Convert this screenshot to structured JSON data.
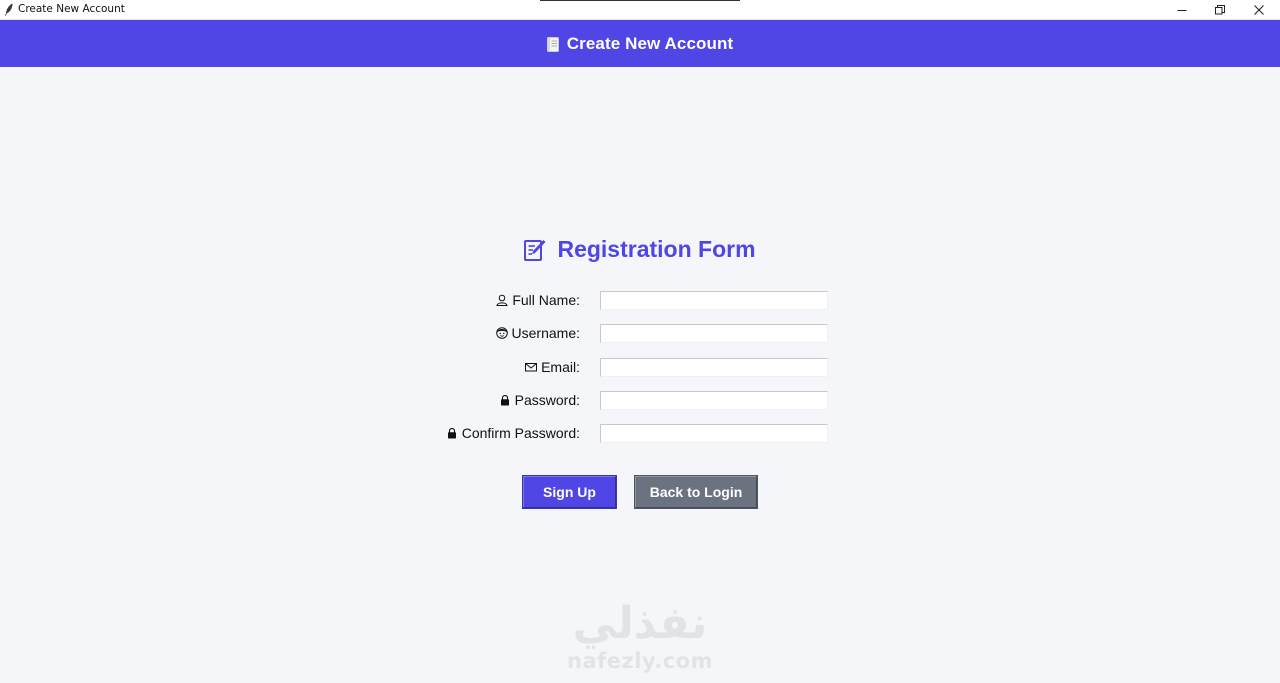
{
  "window": {
    "title": "Create New Account",
    "controls": {
      "minimize": "minimize-icon",
      "maximize": "restore-icon",
      "close": "close-icon"
    }
  },
  "header": {
    "title": "Create New Account",
    "icon": "notebook-icon",
    "background": "#4f46e5"
  },
  "form": {
    "title": "Registration Form",
    "title_icon": "pencil-note-icon",
    "accent": "#4f46e5",
    "fields": [
      {
        "label": "Full Name:",
        "icon": "person-icon",
        "value": ""
      },
      {
        "label": "Username:",
        "icon": "face-icon",
        "value": ""
      },
      {
        "label": "Email:",
        "icon": "envelope-icon",
        "value": ""
      },
      {
        "label": "Password:",
        "icon": "lock-icon",
        "value": ""
      },
      {
        "label": "Confirm Password:",
        "icon": "lock-icon",
        "value": ""
      }
    ],
    "buttons": {
      "signup": "Sign Up",
      "back": "Back to Login"
    },
    "button_colors": {
      "signup": "#4f46e5",
      "back": "#6b7280"
    }
  },
  "watermark": {
    "arabic": "نفذلي",
    "latin": "nafezly.com"
  }
}
